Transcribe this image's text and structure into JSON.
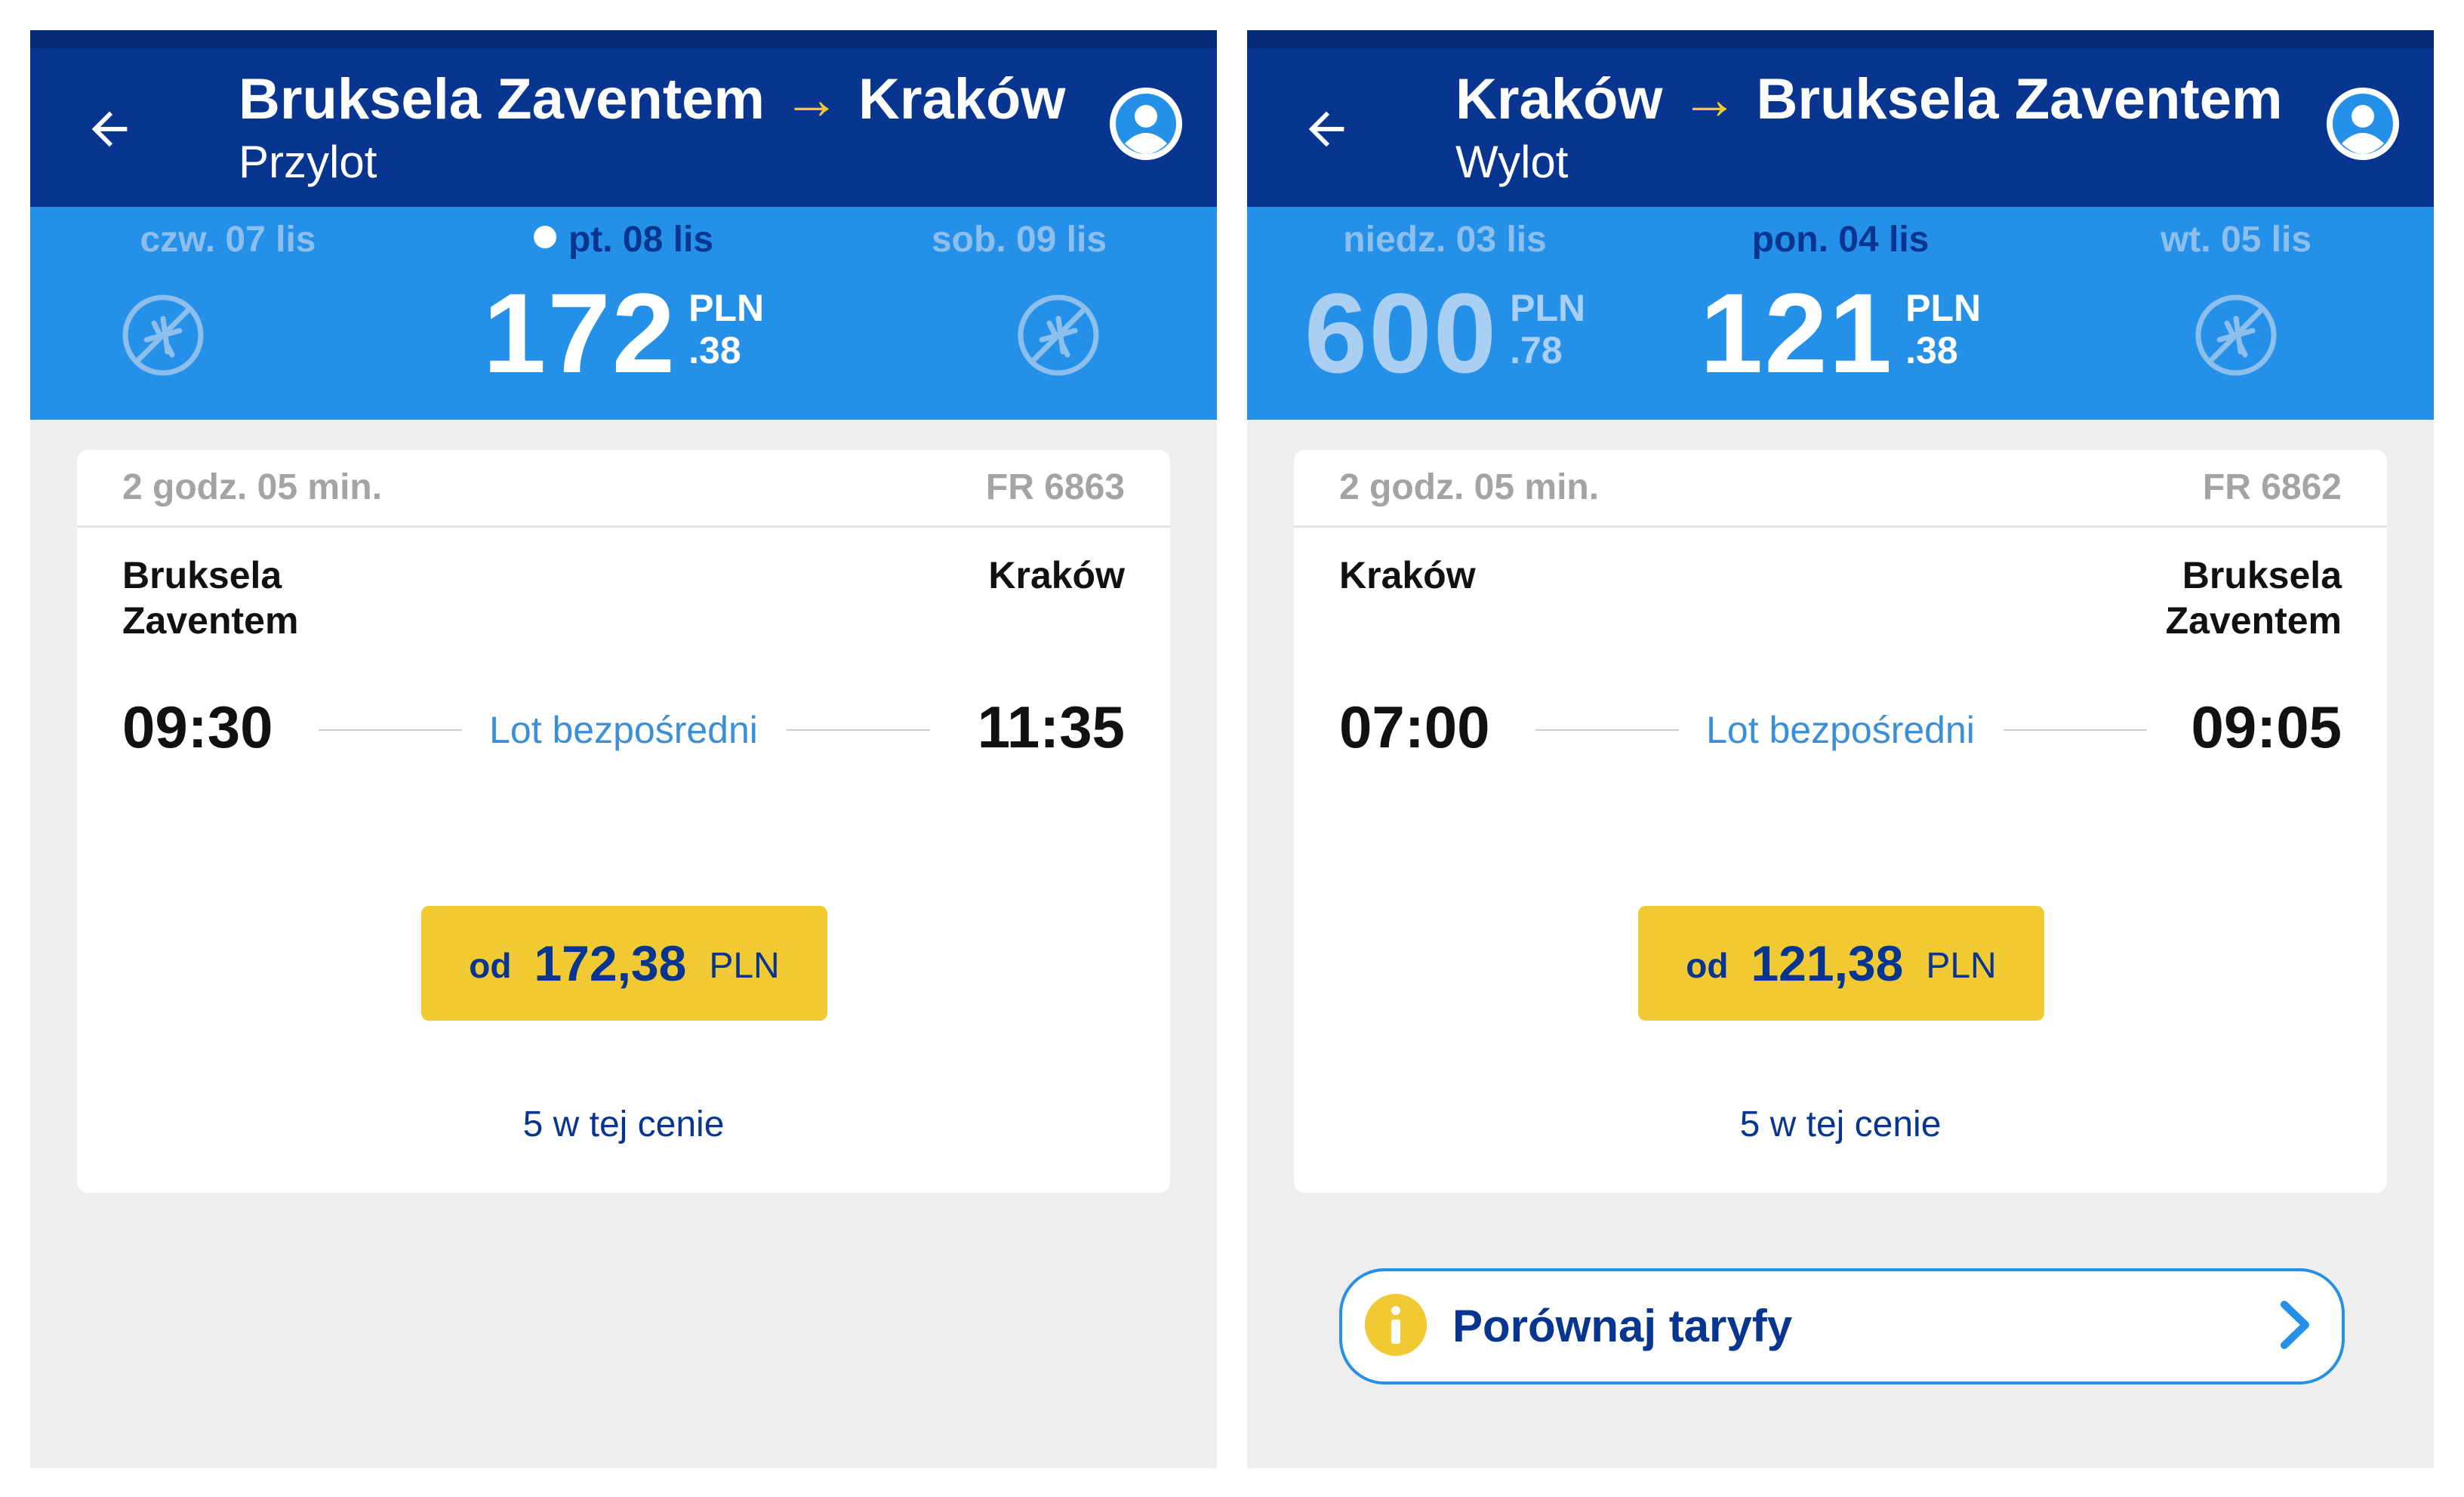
{
  "colors": {
    "header_bg": "#073590",
    "datebar_bg": "#2590e8",
    "accent_yellow": "#f1c933",
    "link_blue": "#3a8fd8",
    "background": "#eeeeee"
  },
  "panels": [
    {
      "route": {
        "from": "Bruksela Zaventem",
        "arrow": "→",
        "to": "Kraków"
      },
      "subtitle": "Przylot",
      "dates": [
        {
          "label": "czw. 07 lis",
          "state": "no-flights",
          "icon": "no-flight-icon"
        },
        {
          "label": "pt. 08 lis",
          "state": "selected",
          "price_int": "172",
          "currency": "PLN",
          "price_dec": ".38"
        },
        {
          "label": "sob. 09 lis",
          "state": "no-flights",
          "icon": "no-flight-icon"
        }
      ],
      "flight": {
        "duration": "2 godz. 05 min.",
        "number": "FR 6863",
        "origin_line1": "Bruksela",
        "origin_line2": "Zaventem",
        "destination_line1": "Kraków",
        "destination_line2": "",
        "depart": "09:30",
        "arrive": "11:35",
        "type": "Lot bezpośredni",
        "price_prefix": "od",
        "price": "172,38",
        "currency": "PLN",
        "seats": "5 w tej cenie"
      }
    },
    {
      "route": {
        "from": "Kraków",
        "arrow": "→",
        "to": "Bruksela Zaventem"
      },
      "subtitle": "Wylot",
      "dates": [
        {
          "label": "niedz. 03 lis",
          "state": "available",
          "price_int": "600",
          "currency": "PLN",
          "price_dec": ".78"
        },
        {
          "label": "pon. 04 lis",
          "state": "selected",
          "price_int": "121",
          "currency": "PLN",
          "price_dec": ".38"
        },
        {
          "label": "wt. 05 lis",
          "state": "no-flights",
          "icon": "no-flight-icon"
        }
      ],
      "flight": {
        "duration": "2 godz. 05 min.",
        "number": "FR 6862",
        "origin_line1": "Kraków",
        "origin_line2": "",
        "destination_line1": "Bruksela",
        "destination_line2": "Zaventem",
        "depart": "07:00",
        "arrive": "09:05",
        "type": "Lot bezpośredni",
        "price_prefix": "od",
        "price": "121,38",
        "currency": "PLN",
        "seats": "5 w tej cenie"
      },
      "compare_fares": {
        "label": "Porównaj taryfy",
        "icon": "info-icon"
      }
    }
  ]
}
